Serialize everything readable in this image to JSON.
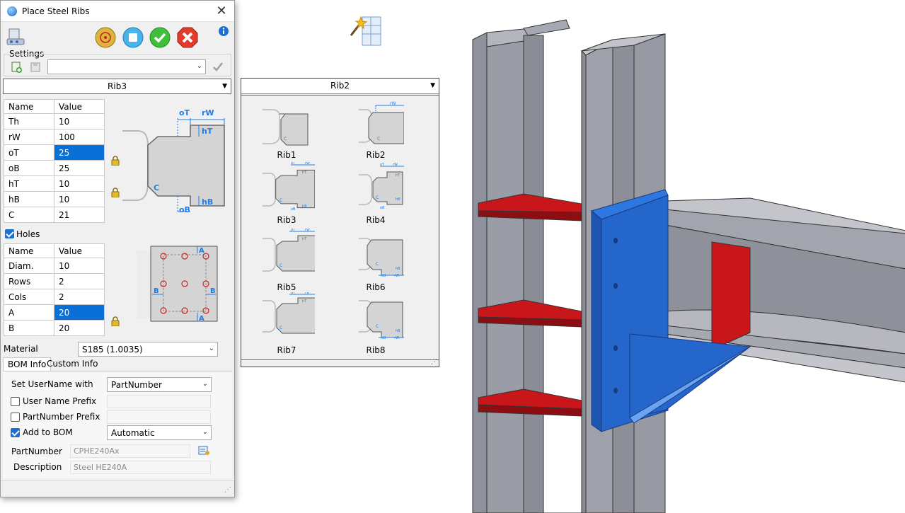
{
  "window": {
    "title": "Place Steel Ribs"
  },
  "settings": {
    "label": "Settings",
    "combo_value": ""
  },
  "rib_select": {
    "value": "Rib3"
  },
  "rib_params": {
    "headers": [
      "Name",
      "Value"
    ],
    "rows": [
      {
        "name": "Th",
        "value": "10"
      },
      {
        "name": "rW",
        "value": "100"
      },
      {
        "name": "oT",
        "value": "25"
      },
      {
        "name": "oB",
        "value": "25"
      },
      {
        "name": "hT",
        "value": "10"
      },
      {
        "name": "hB",
        "value": "10"
      },
      {
        "name": "C",
        "value": "21"
      }
    ],
    "selected_index": 2
  },
  "rib_diagram": {
    "labels": {
      "oT": "oT",
      "rW": "rW",
      "hT": "hT",
      "hB": "hB",
      "oB": "oB",
      "C": "C"
    }
  },
  "holes": {
    "label": "Holes",
    "checked": true,
    "headers": [
      "Name",
      "Value"
    ],
    "rows": [
      {
        "name": "Diam.",
        "value": "10"
      },
      {
        "name": "Rows",
        "value": "2"
      },
      {
        "name": "Cols",
        "value": "2"
      },
      {
        "name": "A",
        "value": "20"
      },
      {
        "name": "B",
        "value": "20"
      }
    ],
    "selected_index": 3,
    "diagram_labels": {
      "A": "A",
      "B": "B"
    }
  },
  "material": {
    "label": "Material",
    "value": "S185  (1.0035)"
  },
  "tabs": {
    "bom": "BOM Info",
    "custom": "Custom Info",
    "active": "bom"
  },
  "bom": {
    "set_username_label": "Set UserName with",
    "set_username_value": "PartNumber",
    "user_name_prefix": {
      "label": "User Name Prefix",
      "checked": false
    },
    "partnumber_prefix": {
      "label": "PartNumber Prefix",
      "checked": false
    },
    "add_to_bom": {
      "label": "Add to BOM",
      "checked": true,
      "value": "Automatic"
    },
    "partnumber": {
      "label": "PartNumber",
      "value": "CPHE240Ax"
    },
    "description": {
      "label": "Description",
      "value": "Steel HE240A"
    }
  },
  "palette": {
    "header": "Rib2",
    "items": [
      "Rib1",
      "Rib2",
      "Rib3",
      "Rib4",
      "Rib5",
      "Rib6",
      "Rib7",
      "Rib8"
    ],
    "mini_labels": {
      "oT": "oT",
      "rW": "rW",
      "hT": "hT",
      "hB": "hB",
      "oB": "oB",
      "C": "C"
    }
  },
  "colors": {
    "accent": "#0a6fd6",
    "rib_red": "#d21c1c",
    "plate_blue": "#1f63c9",
    "steel": "#9a9ca6"
  }
}
